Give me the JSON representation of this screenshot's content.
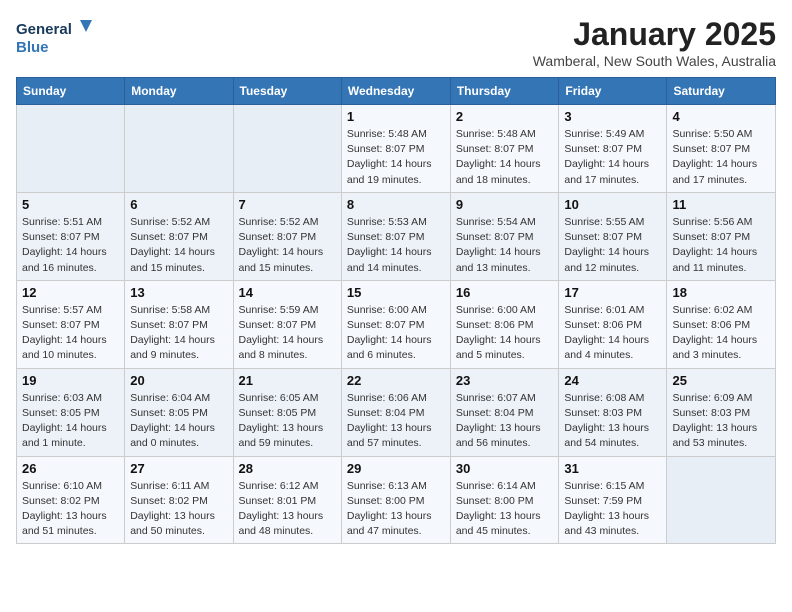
{
  "logo": {
    "line1": "General",
    "line2": "Blue"
  },
  "title": "January 2025",
  "subtitle": "Wamberal, New South Wales, Australia",
  "weekdays": [
    "Sunday",
    "Monday",
    "Tuesday",
    "Wednesday",
    "Thursday",
    "Friday",
    "Saturday"
  ],
  "weeks": [
    [
      {
        "day": "",
        "info": ""
      },
      {
        "day": "",
        "info": ""
      },
      {
        "day": "",
        "info": ""
      },
      {
        "day": "1",
        "info": "Sunrise: 5:48 AM\nSunset: 8:07 PM\nDaylight: 14 hours\nand 19 minutes."
      },
      {
        "day": "2",
        "info": "Sunrise: 5:48 AM\nSunset: 8:07 PM\nDaylight: 14 hours\nand 18 minutes."
      },
      {
        "day": "3",
        "info": "Sunrise: 5:49 AM\nSunset: 8:07 PM\nDaylight: 14 hours\nand 17 minutes."
      },
      {
        "day": "4",
        "info": "Sunrise: 5:50 AM\nSunset: 8:07 PM\nDaylight: 14 hours\nand 17 minutes."
      }
    ],
    [
      {
        "day": "5",
        "info": "Sunrise: 5:51 AM\nSunset: 8:07 PM\nDaylight: 14 hours\nand 16 minutes."
      },
      {
        "day": "6",
        "info": "Sunrise: 5:52 AM\nSunset: 8:07 PM\nDaylight: 14 hours\nand 15 minutes."
      },
      {
        "day": "7",
        "info": "Sunrise: 5:52 AM\nSunset: 8:07 PM\nDaylight: 14 hours\nand 15 minutes."
      },
      {
        "day": "8",
        "info": "Sunrise: 5:53 AM\nSunset: 8:07 PM\nDaylight: 14 hours\nand 14 minutes."
      },
      {
        "day": "9",
        "info": "Sunrise: 5:54 AM\nSunset: 8:07 PM\nDaylight: 14 hours\nand 13 minutes."
      },
      {
        "day": "10",
        "info": "Sunrise: 5:55 AM\nSunset: 8:07 PM\nDaylight: 14 hours\nand 12 minutes."
      },
      {
        "day": "11",
        "info": "Sunrise: 5:56 AM\nSunset: 8:07 PM\nDaylight: 14 hours\nand 11 minutes."
      }
    ],
    [
      {
        "day": "12",
        "info": "Sunrise: 5:57 AM\nSunset: 8:07 PM\nDaylight: 14 hours\nand 10 minutes."
      },
      {
        "day": "13",
        "info": "Sunrise: 5:58 AM\nSunset: 8:07 PM\nDaylight: 14 hours\nand 9 minutes."
      },
      {
        "day": "14",
        "info": "Sunrise: 5:59 AM\nSunset: 8:07 PM\nDaylight: 14 hours\nand 8 minutes."
      },
      {
        "day": "15",
        "info": "Sunrise: 6:00 AM\nSunset: 8:07 PM\nDaylight: 14 hours\nand 6 minutes."
      },
      {
        "day": "16",
        "info": "Sunrise: 6:00 AM\nSunset: 8:06 PM\nDaylight: 14 hours\nand 5 minutes."
      },
      {
        "day": "17",
        "info": "Sunrise: 6:01 AM\nSunset: 8:06 PM\nDaylight: 14 hours\nand 4 minutes."
      },
      {
        "day": "18",
        "info": "Sunrise: 6:02 AM\nSunset: 8:06 PM\nDaylight: 14 hours\nand 3 minutes."
      }
    ],
    [
      {
        "day": "19",
        "info": "Sunrise: 6:03 AM\nSunset: 8:05 PM\nDaylight: 14 hours\nand 1 minute."
      },
      {
        "day": "20",
        "info": "Sunrise: 6:04 AM\nSunset: 8:05 PM\nDaylight: 14 hours\nand 0 minutes."
      },
      {
        "day": "21",
        "info": "Sunrise: 6:05 AM\nSunset: 8:05 PM\nDaylight: 13 hours\nand 59 minutes."
      },
      {
        "day": "22",
        "info": "Sunrise: 6:06 AM\nSunset: 8:04 PM\nDaylight: 13 hours\nand 57 minutes."
      },
      {
        "day": "23",
        "info": "Sunrise: 6:07 AM\nSunset: 8:04 PM\nDaylight: 13 hours\nand 56 minutes."
      },
      {
        "day": "24",
        "info": "Sunrise: 6:08 AM\nSunset: 8:03 PM\nDaylight: 13 hours\nand 54 minutes."
      },
      {
        "day": "25",
        "info": "Sunrise: 6:09 AM\nSunset: 8:03 PM\nDaylight: 13 hours\nand 53 minutes."
      }
    ],
    [
      {
        "day": "26",
        "info": "Sunrise: 6:10 AM\nSunset: 8:02 PM\nDaylight: 13 hours\nand 51 minutes."
      },
      {
        "day": "27",
        "info": "Sunrise: 6:11 AM\nSunset: 8:02 PM\nDaylight: 13 hours\nand 50 minutes."
      },
      {
        "day": "28",
        "info": "Sunrise: 6:12 AM\nSunset: 8:01 PM\nDaylight: 13 hours\nand 48 minutes."
      },
      {
        "day": "29",
        "info": "Sunrise: 6:13 AM\nSunset: 8:00 PM\nDaylight: 13 hours\nand 47 minutes."
      },
      {
        "day": "30",
        "info": "Sunrise: 6:14 AM\nSunset: 8:00 PM\nDaylight: 13 hours\nand 45 minutes."
      },
      {
        "day": "31",
        "info": "Sunrise: 6:15 AM\nSunset: 7:59 PM\nDaylight: 13 hours\nand 43 minutes."
      },
      {
        "day": "",
        "info": ""
      }
    ]
  ]
}
